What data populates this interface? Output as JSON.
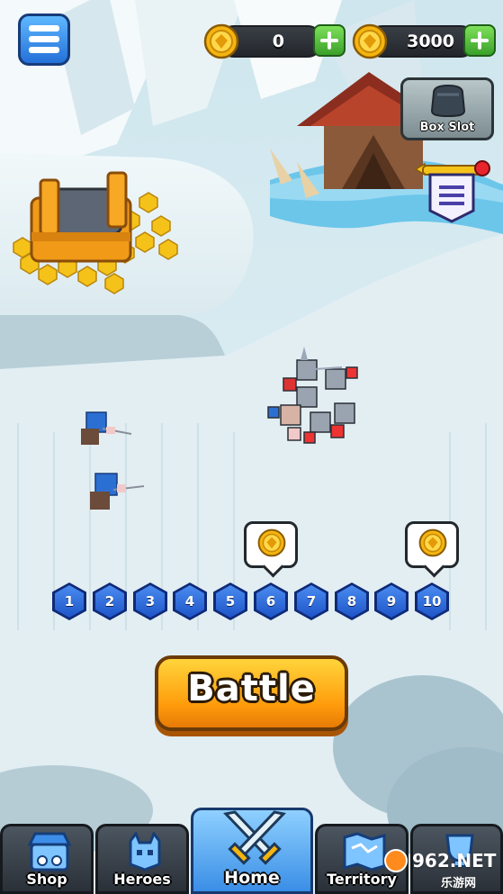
{
  "hud": {
    "menu_icon": "hamburger-menu-icon",
    "currencies": [
      {
        "value": "0",
        "icon": "gold-coin-icon",
        "add_icon": "plus-icon"
      },
      {
        "value": "3000",
        "icon": "gold-coin-icon",
        "add_icon": "plus-icon"
      }
    ],
    "box_slot": {
      "label": "Box Slot",
      "icon": "box-silhouette-icon"
    },
    "quest_icon": "scroll-list-icon"
  },
  "scene": {
    "treasure_icon": "treasure-chest-icon"
  },
  "levels": {
    "items": [
      "1",
      "2",
      "3",
      "4",
      "5",
      "6",
      "7",
      "8",
      "9",
      "10"
    ],
    "reward_bubbles": [
      {
        "level": "6",
        "icon": "gold-coin-icon"
      },
      {
        "level": "10",
        "icon": "gold-coin-icon"
      }
    ]
  },
  "battle_button": {
    "label": "Battle"
  },
  "tabs": [
    {
      "label": "Shop",
      "icon": "shop-icon",
      "active": false
    },
    {
      "label": "Heroes",
      "icon": "hero-helmet-icon",
      "active": false
    },
    {
      "label": "Home",
      "icon": "crossed-swords-icon",
      "active": true
    },
    {
      "label": "Territory",
      "icon": "territory-map-icon",
      "active": false
    },
    {
      "label": "",
      "icon": "trophy-icon",
      "active": false
    }
  ],
  "watermark": {
    "brand": "962.NET",
    "sub": "乐游网"
  },
  "colors": {
    "accent_blue": "#2f7ce0",
    "battle_orange": "#ff9e0d",
    "coin_gold": "#f5b50f",
    "plus_green": "#3aa02a",
    "snow": "#dfeff3"
  }
}
